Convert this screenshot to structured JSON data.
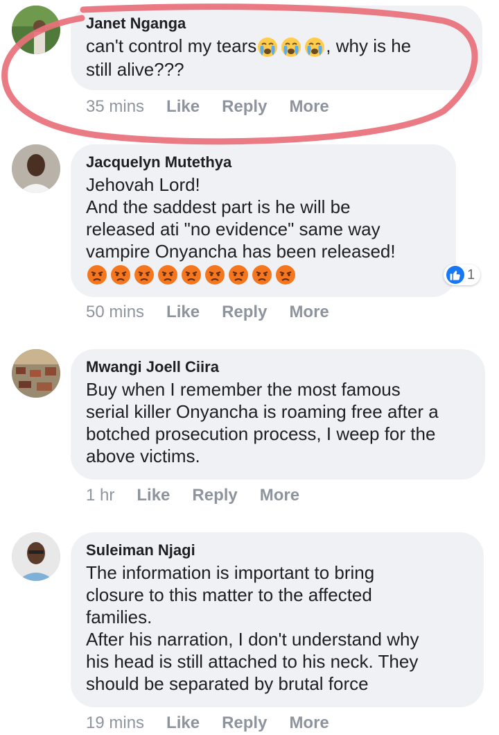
{
  "comments": [
    {
      "author": "Janet Nganga",
      "text_before": "can't control my tears",
      "text_after": ", why is he\nstill alive???",
      "emojis": [
        "crying-face-icon",
        "crying-face-icon",
        "crying-face-icon"
      ],
      "time": "35 mins",
      "like": "Like",
      "reply": "Reply",
      "more": "More"
    },
    {
      "author": "Jacquelyn Mutethya",
      "text": "Jehovah Lord!\nAnd the saddest part is he will be\nreleased ati \"no evidence\" same way\nvampire Onyancha has been released!",
      "emojis": [
        "angry-face-icon",
        "angry-face-icon",
        "angry-face-icon",
        "angry-face-icon",
        "angry-face-icon",
        "angry-face-icon",
        "angry-face-icon",
        "angry-face-icon",
        "angry-face-icon"
      ],
      "reaction_count": "1",
      "time": "50 mins",
      "like": "Like",
      "reply": "Reply",
      "more": "More"
    },
    {
      "author": "Mwangi Joell Ciira",
      "text": "Buy when I remember the most famous\nserial killer Onyancha is roaming free after a\nbotched prosecution process, I weep for the\nabove victims.",
      "time": "1 hr",
      "like": "Like",
      "reply": "Reply",
      "more": "More"
    },
    {
      "author": "Suleiman Njagi",
      "text": "The information is important to bring\nclosure to this matter to the affected\nfamilies.\nAfter his narration, I don't understand why\nhis head is still attached to his neck. They\nshould be separated by brutal force",
      "time": "19 mins",
      "like": "Like",
      "reply": "Reply",
      "more": "More"
    }
  ],
  "colors": {
    "bubble": "#eff1f4",
    "annotation_circle": "#e8707a",
    "like_blue": "#1877f2",
    "meta_gray": "#8d949e"
  }
}
